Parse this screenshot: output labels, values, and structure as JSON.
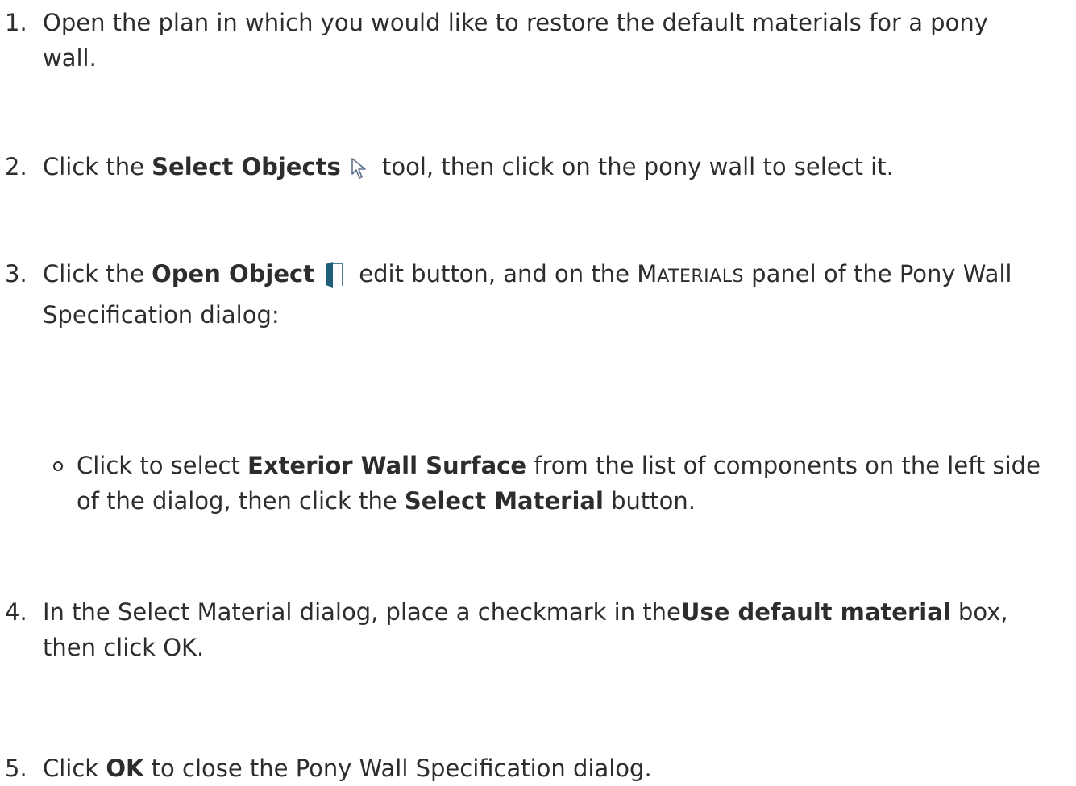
{
  "steps": [
    {
      "number": "1.",
      "line1": "Open the plan in which you would like to restore the default materials for a pony",
      "line2": "wall."
    },
    {
      "number": "2.",
      "prefix": "Click the ",
      "bold": "Select Objects",
      "icon": "select-objects-arrow-icon",
      "suffix": " tool, then click on the pony wall to select it."
    },
    {
      "number": "3.",
      "prefix": "Click the ",
      "bold": "Open Object",
      "icon": "open-object-icon",
      "middle": " edit button, and on the ",
      "panel_first": "M",
      "panel_rest": "ATERIALS",
      "suffix": " panel of the Pony Wall",
      "line2": "Specification dialog:",
      "sub": {
        "prefix": "Click to select ",
        "bold1": "Exterior Wall Surface",
        "middle": " from the list of components on the left side",
        "line2_prefix": "of the dialog, then click the ",
        "bold2": "Select Material",
        "line2_suffix": " button."
      }
    },
    {
      "number": "4.",
      "prefix": "In the Select Material dialog, place a checkmark in the",
      "bold": "Use default material",
      "suffix": " box,",
      "line2": "then click OK."
    },
    {
      "number": "5.",
      "prefix": "Click ",
      "bold": "OK",
      "suffix": " to close the Pony Wall Specification dialog."
    }
  ],
  "colors": {
    "text": "#2d2d2d",
    "icon_blue": "#1f5f7a"
  }
}
